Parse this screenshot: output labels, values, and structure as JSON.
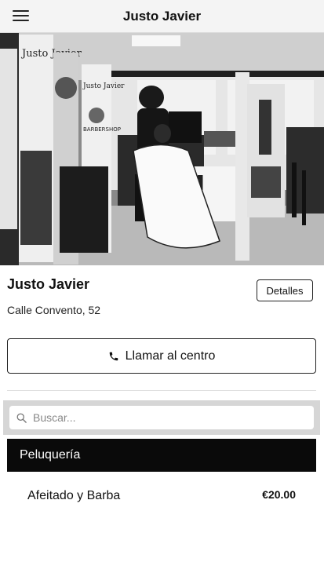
{
  "header": {
    "title": "Justo Javier",
    "menu_icon": "hamburger-menu-icon"
  },
  "hero": {
    "image_label": "Barbershop interior photo",
    "banner_text_left": "Justo Javier",
    "banner_text_mid": "BARBERSHOP",
    "banner_text_right": "Justo Javier"
  },
  "business": {
    "name": "Justo Javier",
    "address": "Calle Convento, 52",
    "details_label": "Detalles"
  },
  "call": {
    "label": "Llamar al centro",
    "icon": "phone-icon"
  },
  "search": {
    "placeholder": "Buscar...",
    "value": "",
    "icon": "search-icon"
  },
  "categories": [
    {
      "name": "Peluquería",
      "services": [
        {
          "name": "Afeitado y Barba",
          "price": "€20.00"
        }
      ]
    }
  ],
  "colors": {
    "category_bg": "#0a0a0a",
    "topbar_bg": "#f4f4f4",
    "search_wrap_bg": "#d6d6d6"
  }
}
